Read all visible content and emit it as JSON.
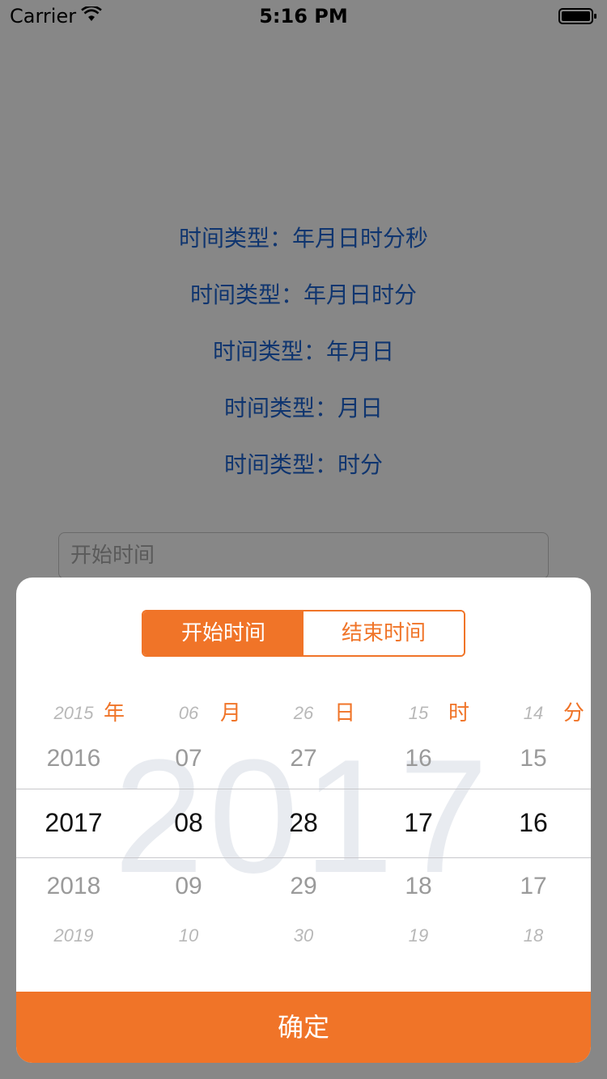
{
  "status_bar": {
    "carrier": "Carrier",
    "time": "5:16 PM"
  },
  "time_types": [
    "时间类型：年月日时分秒",
    "时间类型：年月日时分",
    "时间类型：年月日",
    "时间类型：月日",
    "时间类型：时分"
  ],
  "start_input": {
    "placeholder": "开始时间"
  },
  "picker": {
    "tabs": {
      "start": "开始时间",
      "end": "结束时间"
    },
    "watermark": "2017",
    "columns": [
      {
        "far_top": "2015",
        "near_top": "2016",
        "selected": "2017",
        "near_bottom": "2018",
        "far_bottom": "2019",
        "unit": "年"
      },
      {
        "far_top": "06",
        "near_top": "07",
        "selected": "08",
        "near_bottom": "09",
        "far_bottom": "10",
        "unit": "月"
      },
      {
        "far_top": "26",
        "near_top": "27",
        "selected": "28",
        "near_bottom": "29",
        "far_bottom": "30",
        "unit": "日"
      },
      {
        "far_top": "15",
        "near_top": "16",
        "selected": "17",
        "near_bottom": "18",
        "far_bottom": "19",
        "unit": "时"
      },
      {
        "far_top": "14",
        "near_top": "15",
        "selected": "16",
        "near_bottom": "17",
        "far_bottom": "18",
        "unit": "分"
      }
    ],
    "confirm_label": "确定"
  },
  "colors": {
    "accent": "#f07428",
    "link": "#1e64d2"
  }
}
